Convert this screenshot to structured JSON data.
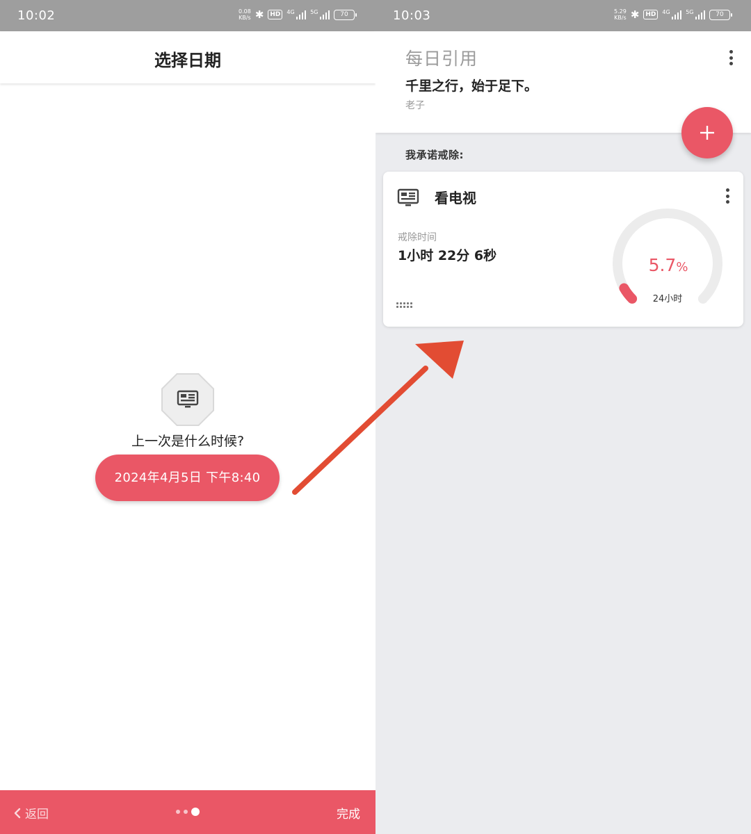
{
  "colors": {
    "accent": "#ea5766",
    "arrow": "#e24c33",
    "status_bar": "#9e9e9e",
    "right_bg": "#ebecef"
  },
  "left_screen": {
    "status_bar": {
      "time": "10:02",
      "speed_value": "0.08",
      "speed_unit": "KB/s",
      "hd": "HD",
      "net1": "4G",
      "net2": "5G",
      "battery": "70"
    },
    "header": {
      "title": "选择日期"
    },
    "icon": "tv-icon",
    "question": "上一次是什么时候?",
    "date_button": "2024年4月5日 下午8:40",
    "footer": {
      "back": "返回",
      "done": "完成",
      "page_dots": 3,
      "active_dot": 3
    }
  },
  "right_screen": {
    "status_bar": {
      "time": "10:03",
      "speed_value": "5.29",
      "speed_unit": "KB/s",
      "hd": "HD",
      "net1": "4G",
      "net2": "5G",
      "battery": "70"
    },
    "quote": {
      "title": "每日引用",
      "text": "千里之行，始于足下。",
      "author": "老子"
    },
    "fab_icon": "plus-icon",
    "section_label": "我承诺戒除:",
    "card": {
      "icon": "tv-icon",
      "title": "看电视",
      "time_label": "戒除时间",
      "time_value": "1小时 22分 6秒",
      "progress": {
        "value": "5.7",
        "unit": "%",
        "fraction": 0.057,
        "subtitle": "24小时"
      }
    }
  }
}
